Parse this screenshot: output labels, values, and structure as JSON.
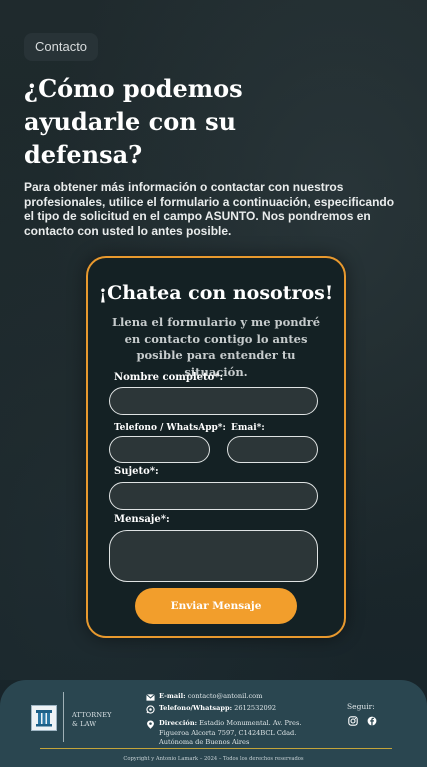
{
  "hero": {
    "tag": "Contacto",
    "headline": "¿Cómo podemos ayudarle con su defensa?",
    "intro": "Para obtener más información o contactar con nuestros profesionales, utilice el formulario a continuación, especificando el tipo de solicitud en el campo ASUNTO. Nos pondremos en contacto con usted lo antes posible."
  },
  "form": {
    "title": "¡Chatea con nosotros!",
    "subtitle": "Llena el formulario y me pondré en contacto contigo lo antes posible para entender tu situación.",
    "name_label": "Nombre completo*:",
    "phone_label": "Telefono / WhatsApp*:",
    "email_label": "Emai*:",
    "subject_label": "Sujeto*:",
    "message_label": "Mensaje*:",
    "submit_label": "Enviar Mensaje",
    "name_value": "",
    "phone_value": "",
    "email_value": "",
    "subject_value": "",
    "message_value": ""
  },
  "footer": {
    "brand_line1": "ATTORNEY",
    "brand_line2": "& LAW",
    "email_key": "E-mail:",
    "email_value": "contacto@antonil.com",
    "phone_key": "Telefono/Whatsapp:",
    "phone_value": "2612532092",
    "address_key": "Dirección:",
    "address_line1": "Estadio Monumental. Av. Pres.",
    "address_line2": "Figueroa Alcorta 7597, C1424BCL Cdad.",
    "address_line3": "Autónoma de Buenos Aires",
    "follow_label": "Seguir:",
    "copyright": "Copyright y Antonio Lamark – 2024 – Todos los derechos reservados"
  },
  "icons": {
    "email": "mail-icon",
    "phone": "whatsapp-icon",
    "address": "location-pin-icon",
    "instagram": "instagram-icon",
    "facebook": "facebook-icon",
    "logo": "pillar-logo-icon"
  },
  "colors": {
    "accent": "#f29e2c",
    "card_border": "#e8992e",
    "footer_bg": "#2a4650",
    "footer_rule": "#c3a43a"
  }
}
